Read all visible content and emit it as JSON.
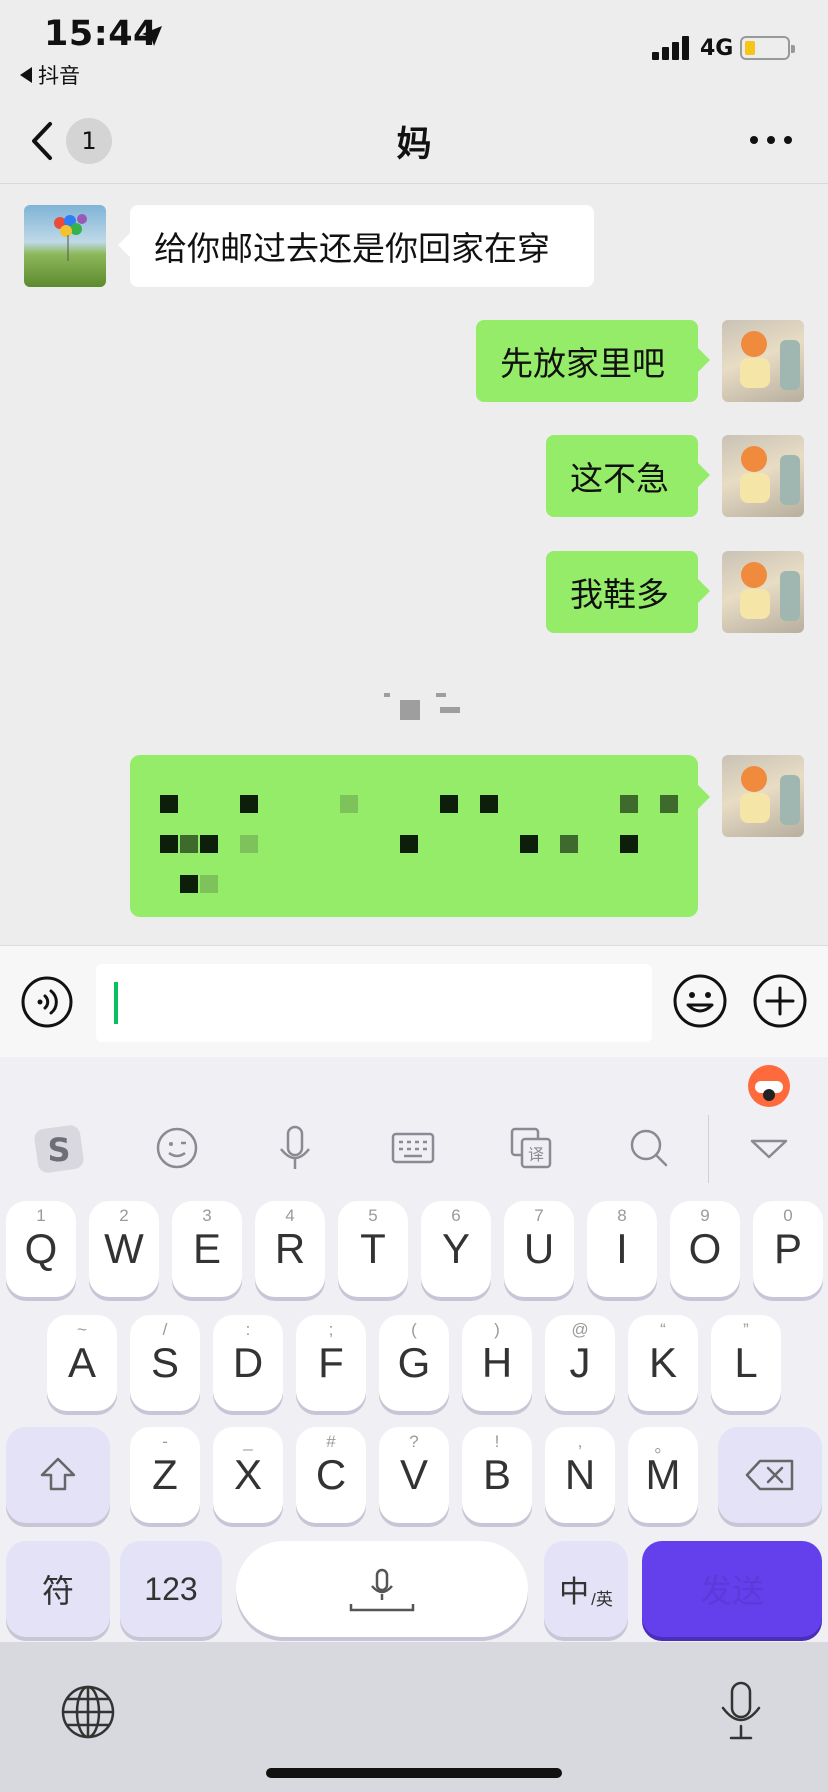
{
  "status_bar": {
    "time": "15:44",
    "back_app": "抖音",
    "network": "4G",
    "icons": [
      "location-arrow-icon",
      "signal-icon",
      "battery-icon"
    ]
  },
  "nav": {
    "unread_count": "1",
    "title": "妈",
    "icons": [
      "back-chevron-icon",
      "more-dots-icon"
    ]
  },
  "messages": [
    {
      "side": "left",
      "text": "给你邮过去还是你回家在穿"
    },
    {
      "side": "right",
      "text": "先放家里吧"
    },
    {
      "side": "right",
      "text": "这不急"
    },
    {
      "side": "right",
      "text": "我鞋多"
    },
    {
      "side": "right",
      "text": "",
      "note_redacted": true
    }
  ],
  "input_bar": {
    "value": "",
    "icons": [
      "voice-icon",
      "emoji-icon",
      "plus-icon"
    ]
  },
  "keyboard": {
    "toolbar_icons": [
      "sogou-logo-icon",
      "emoji-face-icon",
      "microphone-icon",
      "keyboard-icon",
      "translate-icon",
      "search-icon",
      "collapse-icon"
    ],
    "row1": [
      {
        "k": "Q",
        "s": "1"
      },
      {
        "k": "W",
        "s": "2"
      },
      {
        "k": "E",
        "s": "3"
      },
      {
        "k": "R",
        "s": "4"
      },
      {
        "k": "T",
        "s": "5"
      },
      {
        "k": "Y",
        "s": "6"
      },
      {
        "k": "U",
        "s": "7"
      },
      {
        "k": "I",
        "s": "8"
      },
      {
        "k": "O",
        "s": "9"
      },
      {
        "k": "P",
        "s": "0"
      }
    ],
    "row2": [
      {
        "k": "A",
        "s": "~"
      },
      {
        "k": "S",
        "s": "/"
      },
      {
        "k": "D",
        "s": ":"
      },
      {
        "k": "F",
        "s": ";"
      },
      {
        "k": "G",
        "s": "("
      },
      {
        "k": "H",
        "s": ")"
      },
      {
        "k": "J",
        "s": "@"
      },
      {
        "k": "K",
        "s": "“"
      },
      {
        "k": "L",
        "s": "”"
      }
    ],
    "row3": [
      {
        "k": "Z",
        "s": "-"
      },
      {
        "k": "X",
        "s": "_"
      },
      {
        "k": "C",
        "s": "#"
      },
      {
        "k": "V",
        "s": "?"
      },
      {
        "k": "B",
        "s": "!"
      },
      {
        "k": "N",
        "s": ","
      },
      {
        "k": "M",
        "s": "。"
      }
    ],
    "symbols_label": "符",
    "numbers_label": "123",
    "lang_zh": "中",
    "lang_en": "/英",
    "send_label": "发送",
    "colors": {
      "send": "#6440EC",
      "func_key": "#E4E2F6"
    }
  },
  "bottom": {
    "icons": [
      "globe-icon",
      "dictation-mic-icon"
    ]
  }
}
